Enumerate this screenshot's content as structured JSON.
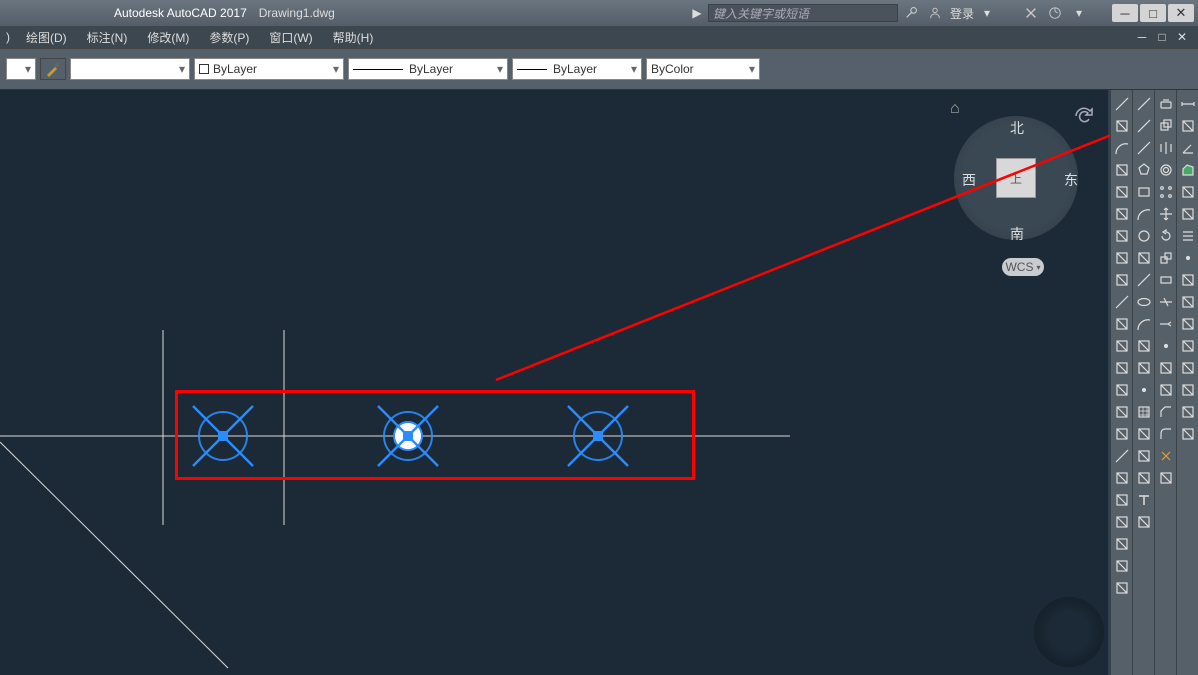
{
  "titlebar": {
    "app_name": "Autodesk AutoCAD 2017",
    "filename": "Drawing1.dwg",
    "search_placeholder": "键入关键字或短语",
    "login_label": "登录"
  },
  "menubar": {
    "items": [
      {
        "label": "绘图(D)"
      },
      {
        "label": "标注(N)"
      },
      {
        "label": "修改(M)"
      },
      {
        "label": "参数(P)"
      },
      {
        "label": "窗口(W)"
      },
      {
        "label": "帮助(H)"
      }
    ]
  },
  "properties": {
    "color_label": "ByLayer",
    "linetype_label": "ByLayer",
    "lineweight_label": "ByLayer",
    "plotstyle_label": "ByColor"
  },
  "viewcube": {
    "top_face": "上",
    "north": "北",
    "south": "南",
    "east": "东",
    "west": "西",
    "wcs_label": "WCS"
  },
  "tool_columns": [
    {
      "name": "dimension-palette",
      "icons": [
        "dim-linear",
        "dim-aligned",
        "dim-arc",
        "dim-ordinate",
        "dim-radius",
        "dim-jogged",
        "dim-diameter",
        "dim-angular",
        "dim-quick",
        "dim-baseline",
        "dim-continue",
        "dim-space",
        "dim-break",
        "tolerance",
        "center-mark",
        "inspect",
        "jogged-linear",
        "dim-edit",
        "dim-tedit",
        "dim-update",
        "dim-style",
        "dim-assoc",
        "dim-override"
      ]
    },
    {
      "name": "draw-palette",
      "icons": [
        "line",
        "construction-line",
        "polyline",
        "polygon",
        "rectangle",
        "arc",
        "circle",
        "revision-cloud",
        "spline",
        "ellipse",
        "ellipse-arc",
        "insert-block",
        "make-block",
        "point",
        "hatch",
        "gradient",
        "region",
        "table",
        "mtext",
        "add-selected"
      ]
    },
    {
      "name": "modify-palette",
      "icons": [
        "erase",
        "copy",
        "mirror",
        "offset",
        "array",
        "move",
        "rotate",
        "scale",
        "stretch",
        "trim",
        "extend",
        "break-point",
        "break",
        "join",
        "chamfer",
        "fillet",
        "explode",
        "draw-order"
      ]
    },
    {
      "name": "measure-palette",
      "icons": [
        "distance",
        "radius",
        "angle",
        "area",
        "volume",
        "region-massprop",
        "list",
        "id-point",
        "time",
        "status",
        "setvar",
        "divide",
        "measure",
        "quickcalc",
        "layer-translate",
        "check-standards"
      ]
    }
  ]
}
